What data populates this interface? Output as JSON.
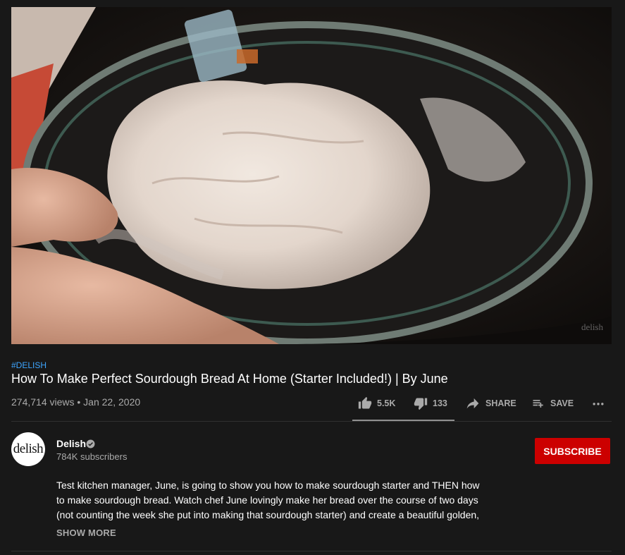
{
  "video": {
    "watermark": "delish",
    "hashtag": "#DELISH",
    "title": "How To Make Perfect Sourdough Bread At Home (Starter Included!) | By June",
    "meta": "274,714 views • Jan 22, 2020"
  },
  "actions": {
    "like_count": "5.5K",
    "dislike_count": "133",
    "share_label": "SHARE",
    "save_label": "SAVE",
    "like_ratio": 0.976
  },
  "channel": {
    "avatar_text": "delish",
    "name": "Delish",
    "subscribers": "784K subscribers",
    "subscribe_label": "SUBSCRIBE"
  },
  "description": {
    "lines": [
      "Test kitchen manager, June, is going to show you how to make sourdough starter and THEN how",
      "to make sourdough bread. Watch chef June lovingly make her bread over the course of two days",
      "(not counting the week she put into making that sourdough starter) and create a beautiful golden,"
    ],
    "show_more_label": "SHOW MORE"
  },
  "icons": {
    "like": "thumbs-up-icon",
    "dislike": "thumbs-down-icon",
    "share": "share-arrow-icon",
    "save": "playlist-add-icon",
    "more": "more-horizontal-icon",
    "verified": "verified-check-icon"
  },
  "colors": {
    "background": "#181818",
    "accent_link": "#3ea6ff",
    "subscribe": "#cc0000",
    "secondary_text": "#aaaaaa"
  }
}
